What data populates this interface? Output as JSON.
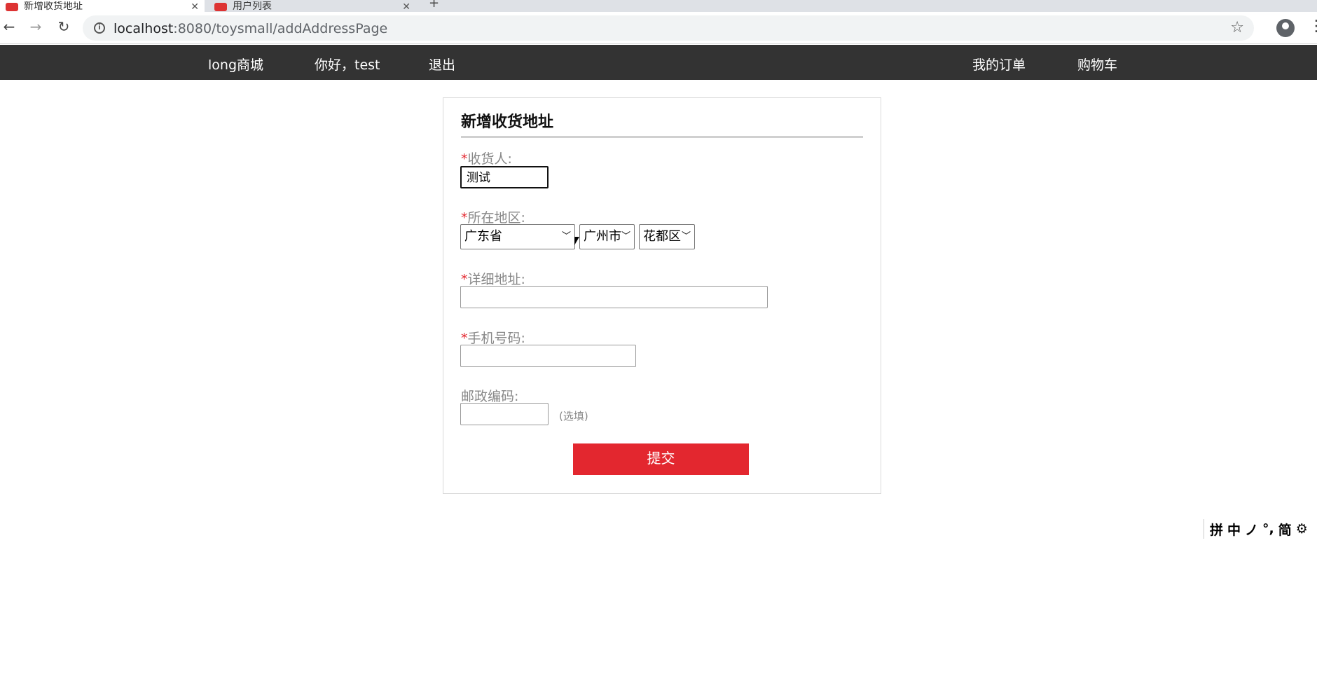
{
  "browser": {
    "tabs": [
      {
        "title": "新增收货地址"
      },
      {
        "title": "用户列表"
      }
    ],
    "url_host": "localhost",
    "url_rest": ":8080/toysmall/addAddressPage"
  },
  "site_nav": {
    "brand": "long商城",
    "greeting": "你好，test",
    "logout": "退出",
    "orders": "我的订单",
    "cart": "购物车"
  },
  "form": {
    "title": "新增收货地址",
    "required_mark": "*",
    "receiver_label": "收货人:",
    "receiver_value": "测试",
    "region_label": "所在地区:",
    "province": "广东省",
    "city": "广州市",
    "district": "花都区",
    "address_label": "详细地址:",
    "address_value": "",
    "phone_label": "手机号码:",
    "phone_value": "",
    "postcode_label": "邮政编码:",
    "postcode_value": "",
    "postcode_hint": "(选填)",
    "submit_label": "提交"
  },
  "ime": {
    "items": [
      "拼",
      "中",
      "ノ",
      "°,",
      "简",
      "⚙"
    ]
  },
  "colors": {
    "header_bg": "#333333",
    "accent": "#e3272f"
  }
}
